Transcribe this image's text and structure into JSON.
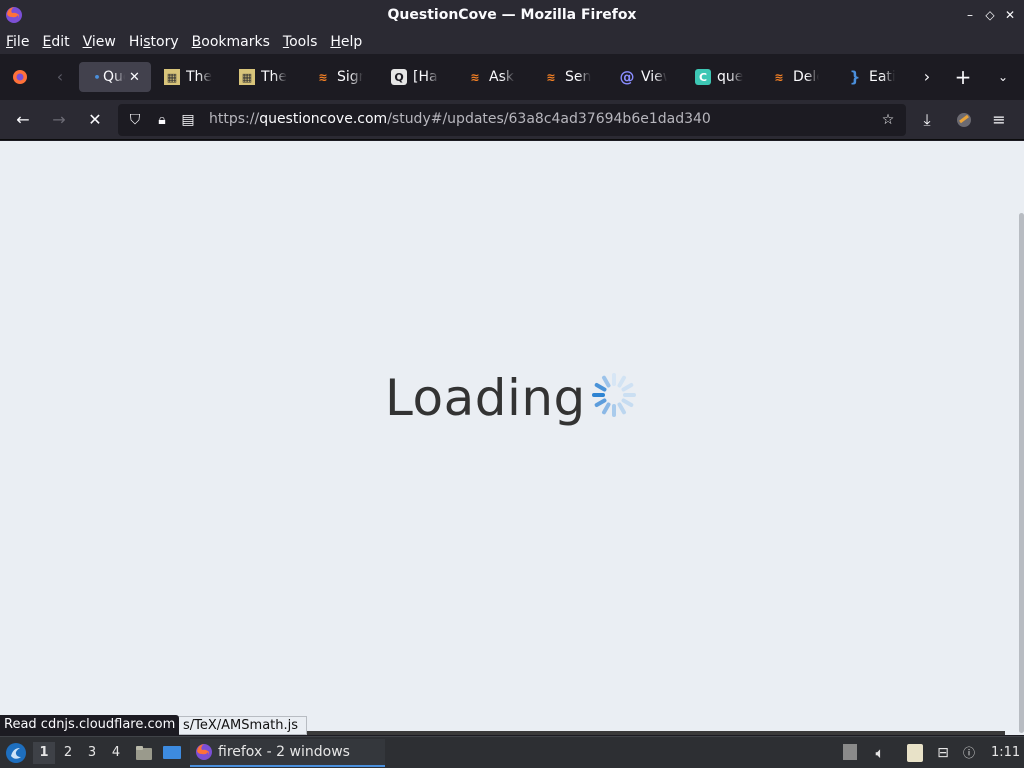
{
  "window": {
    "title": "QuestionCove — Mozilla Firefox",
    "controls": [
      "minimize",
      "restore",
      "close"
    ]
  },
  "menu": {
    "items": [
      "File",
      "Edit",
      "View",
      "History",
      "Bookmarks",
      "Tools",
      "Help"
    ],
    "mnemonics": [
      "F",
      "E",
      "V",
      "s",
      "B",
      "T",
      "H"
    ]
  },
  "tabs": [
    {
      "label": "QuestionCove",
      "icon": "questioncove-icon",
      "active": true
    },
    {
      "label": "The",
      "icon": "film-icon"
    },
    {
      "label": "The",
      "icon": "film-icon"
    },
    {
      "label": "Signal",
      "icon": "stackoverflow-icon"
    },
    {
      "label": "[Hard",
      "icon": "quora-icon"
    },
    {
      "label": "Ask",
      "icon": "stackoverflow-icon"
    },
    {
      "label": "Senior",
      "icon": "stackoverflow-icon"
    },
    {
      "label": "View",
      "icon": "at-icon"
    },
    {
      "label": "question",
      "icon": "c-icon"
    },
    {
      "label": "Delete",
      "icon": "stackoverflow-icon"
    },
    {
      "label": "Eating",
      "icon": "braces-icon"
    }
  ],
  "navbar": {
    "url_prefix": "https://",
    "url_domain": "questioncove.com",
    "url_path": "/study#/updates/63a8c4ad37694b6e1dad340"
  },
  "page": {
    "loading_text": "Loading"
  },
  "status": {
    "text": "Read cdnjs.cloudflare.com",
    "underlying_text": "s/TeX/AMSmath.js"
  },
  "taskbar": {
    "workspaces": [
      "1",
      "2",
      "3",
      "4"
    ],
    "active_workspace": "1",
    "task_label": "firefox - 2 windows",
    "clock": "1:11"
  },
  "colors": {
    "accent": "#4a8fdc",
    "page_bg": "#eaeef3",
    "chrome_bg": "#2b2a33"
  }
}
